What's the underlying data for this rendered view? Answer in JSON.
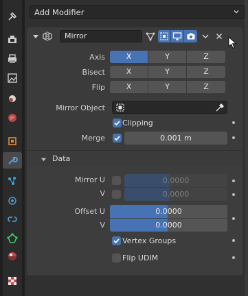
{
  "toolbar": {
    "add_modifier": "Add Modifier"
  },
  "modifier": {
    "name": "Mirror",
    "axis_label": "Axis",
    "bisect_label": "Bisect",
    "flip_label": "Flip",
    "axes": [
      "X",
      "Y",
      "Z"
    ],
    "axis_selected": "X",
    "mirror_object_label": "Mirror Object",
    "clipping_label": "Clipping",
    "clipping": true,
    "merge_label": "Merge",
    "merge_enabled": true,
    "merge_value": "0.001 m"
  },
  "data_panel": {
    "title": "Data",
    "mirror_u_label": "Mirror U",
    "v_label": "V",
    "mirror_u_value": "0.0000",
    "mirror_v_value": "0.0000",
    "offset_u_label": "Offset U",
    "offset_v_label": "V",
    "offset_u_value": "0.0000",
    "offset_v_value": "0.0000",
    "vertex_groups_label": "Vertex Groups",
    "vertex_groups": true,
    "flip_udim_label": "Flip UDIM",
    "flip_udim": false
  },
  "colors": {
    "accent": "#4772b3",
    "panel": "#3b3b3b",
    "background": "#303030"
  }
}
